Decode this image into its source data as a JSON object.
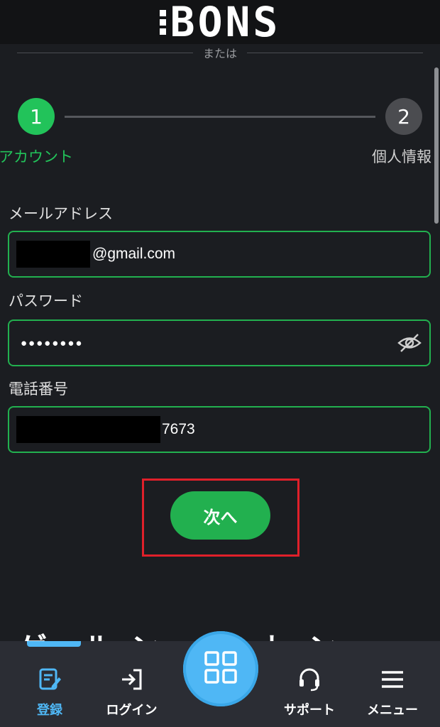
{
  "header": {
    "logo_text": "BONS"
  },
  "divider_text": "または",
  "stepper": {
    "steps": [
      {
        "number": "1",
        "label": "アカウント",
        "state": "active"
      },
      {
        "number": "2",
        "label": "個人情報",
        "state": "inactive"
      }
    ]
  },
  "form": {
    "email": {
      "label": "メールアドレス",
      "value": "@gmail.com"
    },
    "password": {
      "label": "パスワード",
      "value": "●●●●●●●●"
    },
    "phone": {
      "label": "電話番号",
      "value": "7673"
    },
    "next_label": "次へ"
  },
  "bottom_nav": {
    "items": [
      {
        "label": "登録",
        "icon": "register-icon",
        "active": true
      },
      {
        "label": "ログイン",
        "icon": "login-icon",
        "active": false
      },
      {
        "label": "",
        "icon": "grid-icon",
        "active": false
      },
      {
        "label": "サポート",
        "icon": "headset-icon",
        "active": false
      },
      {
        "label": "メニュー",
        "icon": "hamburger-icon",
        "active": false
      }
    ]
  },
  "colors": {
    "accent_green": "#22c35a",
    "nav_blue": "#4fb7f5",
    "highlight_red": "#e0202a",
    "background": "#1b1d21"
  }
}
